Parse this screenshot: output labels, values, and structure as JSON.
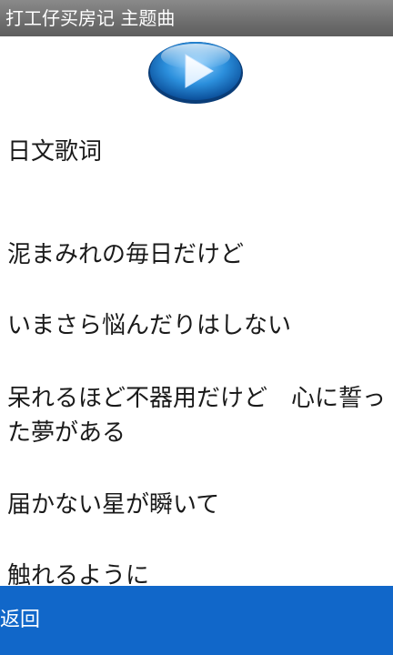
{
  "titlebar": {
    "title": "打工仔买房记 主题曲"
  },
  "player": {
    "play_icon": "play-icon",
    "accent": "#2b8fdc"
  },
  "content": {
    "heading": "日文歌词",
    "lines": [
      "泥まみれの毎日だけど",
      "いまさら悩んだりはしない",
      "呆れるほど不器用だけど　心に誓った夢がある",
      "届かない星が瞬いて",
      "触れるように"
    ]
  },
  "footer": {
    "back_label": "返回",
    "color": "#1167c9"
  }
}
